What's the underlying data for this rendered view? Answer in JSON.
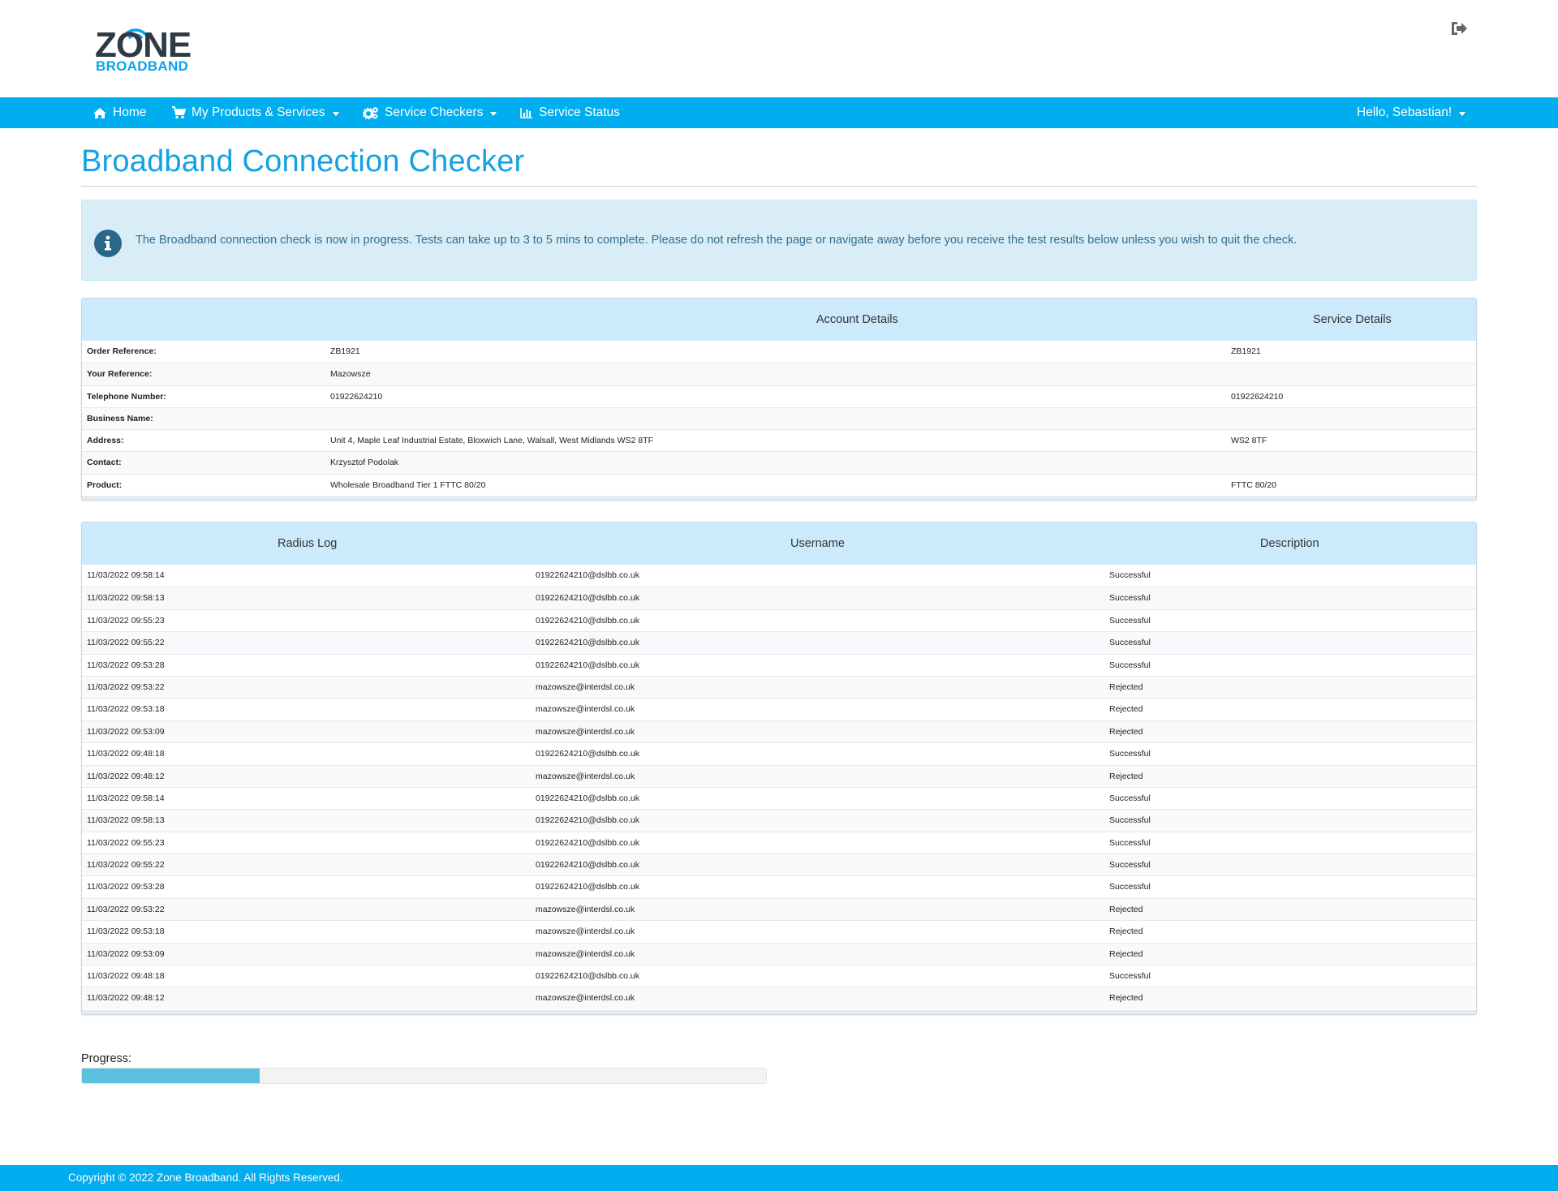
{
  "brand": {
    "logo_word": "ZONE",
    "logo_sub": "BROADBAND"
  },
  "header": {
    "logout_icon": "sign-out-icon"
  },
  "nav": {
    "items": [
      {
        "label": "Home",
        "icon": "home-icon"
      },
      {
        "label": "My Products & Services",
        "icon": "shopping-cart-icon",
        "dropdown": true
      },
      {
        "label": "Service Checkers",
        "icon": "gears-icon",
        "dropdown": true
      },
      {
        "label": "Service Status",
        "icon": "bar-chart-icon"
      }
    ],
    "user_greeting": "Hello, Sebastian!"
  },
  "page": {
    "title": "Broadband Connection Checker",
    "info_message": "The Broadband connection check is now in progress. Tests can take up to 3 to 5 mins to complete. Please do not refresh the page or navigate away before you receive the test results below unless you wish to quit the check."
  },
  "account_table": {
    "headers": [
      "",
      "Account Details",
      "Service Details"
    ],
    "rows": [
      {
        "label": "Order Reference:",
        "account": "ZB1921",
        "service": "ZB1921"
      },
      {
        "label": "Your Reference:",
        "account": "Mazowsze",
        "service": ""
      },
      {
        "label": "Telephone Number:",
        "account": "01922624210",
        "service": "01922624210"
      },
      {
        "label": "Business Name:",
        "account": "",
        "service": ""
      },
      {
        "label": "Address:",
        "account": "Unit 4, Maple Leaf Industrial Estate, Bloxwich Lane, Walsall, West Midlands WS2 8TF",
        "service": "WS2 8TF"
      },
      {
        "label": "Contact:",
        "account": "Krzysztof Podolak",
        "service": ""
      },
      {
        "label": "Product:",
        "account": "Wholesale Broadband Tier 1 FTTC 80/20",
        "service": "FTTC 80/20"
      }
    ]
  },
  "radius_table": {
    "headers": [
      "Radius Log",
      "Username",
      "Description"
    ],
    "rows": [
      {
        "time": "11/03/2022 09:58:14",
        "username": "01922624210@dslbb.co.uk",
        "description": "Successful"
      },
      {
        "time": "11/03/2022 09:58:13",
        "username": "01922624210@dslbb.co.uk",
        "description": "Successful"
      },
      {
        "time": "11/03/2022 09:55:23",
        "username": "01922624210@dslbb.co.uk",
        "description": "Successful"
      },
      {
        "time": "11/03/2022 09:55:22",
        "username": "01922624210@dslbb.co.uk",
        "description": "Successful"
      },
      {
        "time": "11/03/2022 09:53:28",
        "username": "01922624210@dslbb.co.uk",
        "description": "Successful"
      },
      {
        "time": "11/03/2022 09:53:22",
        "username": "mazowsze@interdsl.co.uk",
        "description": "Rejected"
      },
      {
        "time": "11/03/2022 09:53:18",
        "username": "mazowsze@interdsl.co.uk",
        "description": "Rejected"
      },
      {
        "time": "11/03/2022 09:53:09",
        "username": "mazowsze@interdsl.co.uk",
        "description": "Rejected"
      },
      {
        "time": "11/03/2022 09:48:18",
        "username": "01922624210@dslbb.co.uk",
        "description": "Successful"
      },
      {
        "time": "11/03/2022 09:48:12",
        "username": "mazowsze@interdsl.co.uk",
        "description": "Rejected"
      },
      {
        "time": "11/03/2022 09:58:14",
        "username": "01922624210@dslbb.co.uk",
        "description": "Successful"
      },
      {
        "time": "11/03/2022 09:58:13",
        "username": "01922624210@dslbb.co.uk",
        "description": "Successful"
      },
      {
        "time": "11/03/2022 09:55:23",
        "username": "01922624210@dslbb.co.uk",
        "description": "Successful"
      },
      {
        "time": "11/03/2022 09:55:22",
        "username": "01922624210@dslbb.co.uk",
        "description": "Successful"
      },
      {
        "time": "11/03/2022 09:53:28",
        "username": "01922624210@dslbb.co.uk",
        "description": "Successful"
      },
      {
        "time": "11/03/2022 09:53:22",
        "username": "mazowsze@interdsl.co.uk",
        "description": "Rejected"
      },
      {
        "time": "11/03/2022 09:53:18",
        "username": "mazowsze@interdsl.co.uk",
        "description": "Rejected"
      },
      {
        "time": "11/03/2022 09:53:09",
        "username": "mazowsze@interdsl.co.uk",
        "description": "Rejected"
      },
      {
        "time": "11/03/2022 09:48:18",
        "username": "01922624210@dslbb.co.uk",
        "description": "Successful"
      },
      {
        "time": "11/03/2022 09:48:12",
        "username": "mazowsze@interdsl.co.uk",
        "description": "Rejected"
      }
    ]
  },
  "progress": {
    "label": "Progress:",
    "fraction": 0.26
  },
  "footer": {
    "copyright": "Copyright © 2022 Zone Broadband. All Rights Reserved."
  },
  "colors": {
    "brand_blue": "#00adef",
    "title_blue": "#12a2e3",
    "table_header_bg": "#cbebfb",
    "info_bg": "#d9edf7",
    "info_text": "#31708f",
    "progress_fill": "#5bc0de"
  }
}
